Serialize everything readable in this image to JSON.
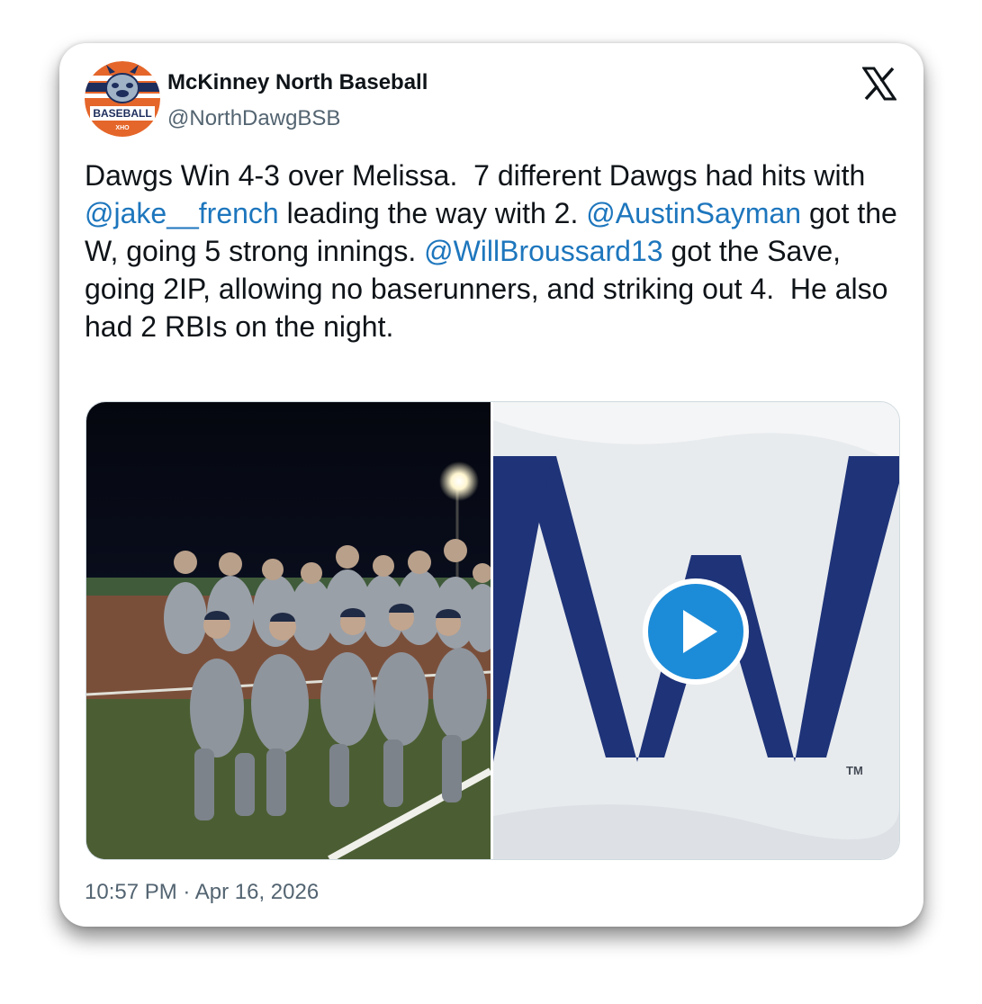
{
  "tweet": {
    "display_name": "McKinney North Baseball",
    "handle": "@NorthDawgBSB",
    "avatar": {
      "icon": "bulldog-baseball-logo-icon",
      "label": "BASEBALL",
      "sub_label": "XHO"
    },
    "platform_icon": "x-logo-icon",
    "text_segments": [
      {
        "text": "Dawgs Win 4-3 over Melissa.  7 different Dawgs had hits with ",
        "type": "text"
      },
      {
        "text": "@jake__french",
        "type": "mention"
      },
      {
        "text": " leading the way with 2. ",
        "type": "text"
      },
      {
        "text": "@AustinSayman",
        "type": "mention"
      },
      {
        "text": " got the W, going 5 strong innings. ",
        "type": "text"
      },
      {
        "text": "@WillBroussard13",
        "type": "mention"
      },
      {
        "text": " got the Save, going 2IP, allowing no baserunners, and striking out 4.  He also had 2 RBIs on the night.",
        "type": "text"
      }
    ],
    "media": [
      {
        "kind": "photo",
        "description_icon": "team-photo-image"
      },
      {
        "kind": "video",
        "icon": "play-icon",
        "trademark": "TM"
      }
    ],
    "timestamp": "10:57 PM · Apr 16, 2026"
  },
  "colors": {
    "mention": "#1d76bd",
    "play_button": "#1d8cd8",
    "w_flag": "#1e3378",
    "secondary_text": "#536471",
    "avatar_orange": "#e5662a",
    "avatar_navy": "#1d2d5c"
  }
}
